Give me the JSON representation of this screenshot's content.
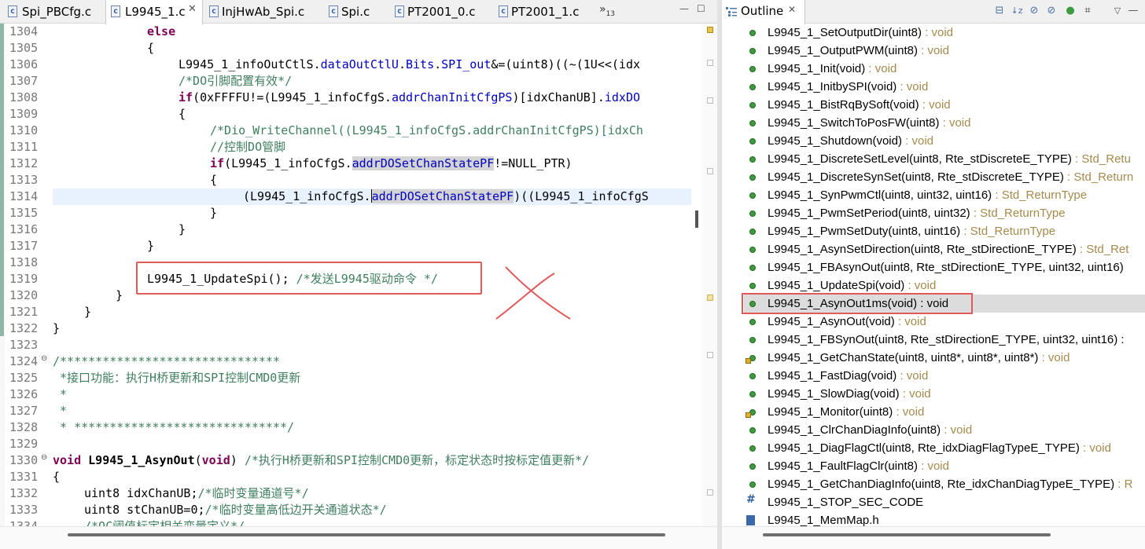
{
  "editor": {
    "tabs": [
      {
        "label": "Spi_PBCfg.c",
        "active": false
      },
      {
        "label": "L9945_1.c",
        "active": true
      },
      {
        "label": "InjHwAb_Spi.c",
        "active": false
      },
      {
        "label": "Spi.c",
        "active": false
      },
      {
        "label": "PT2001_0.c",
        "active": false
      },
      {
        "label": "PT2001_1.c",
        "active": false
      }
    ],
    "overflow_label": "»",
    "overflow_count": "13",
    "line_numbers": [
      "1304",
      "1305",
      "1306",
      "1307",
      "1308",
      "1309",
      "1310",
      "1311",
      "1312",
      "1313",
      "1314",
      "1315",
      "1316",
      "1317",
      "1318",
      "1319",
      "1320",
      "1321",
      "1322",
      "1323",
      "1324",
      "1325",
      "1326",
      "1327",
      "1328",
      "1329",
      "1330",
      "1331",
      "1332",
      "1333",
      "1334"
    ],
    "code": {
      "l1304_kw": "else",
      "l1305": "{",
      "l1306_a": "L9945_1_infoOutCtlS.",
      "l1306_f1": "dataOutCtlU",
      "l1306_b": ".",
      "l1306_f2": "Bits",
      "l1306_c": ".",
      "l1306_f3": "SPI_out",
      "l1306_d": "&=(uint8)((~(1U<<(idx",
      "l1307_cm": "/*DO引脚配置有效*/",
      "l1308_kw": "if",
      "l1308_a": "(0xFFFFU!=(L9945_1_infoCfgS.",
      "l1308_f1": "addrChanInitCfgPS",
      "l1308_b": ")[idxChanUB].",
      "l1308_f2": "idxDO",
      "l1309": "{",
      "l1310_cm": "/*Dio_WriteChannel((L9945_1_infoCfgS.addrChanInitCfgPS)[idxCh",
      "l1311_cm": "//控制DO管脚",
      "l1312_kw": "if",
      "l1312_a": "(L9945_1_infoCfgS.",
      "l1312_f1": "addrDOSetChanStatePF",
      "l1312_b": "!=NULL_PTR)",
      "l1313": "{",
      "l1314_a": "(L9945_1_infoCfgS.",
      "l1314_f1a": "a",
      "l1314_f1b": "ddrDOSetChanStatePF",
      "l1314_b": ")((L9945_1_infoCfgS",
      "l1315": "}",
      "l1316": "}",
      "l1317": "}",
      "l1319_a": "L9945_1_UpdateSpi(); ",
      "l1319_cm": "/*发送L9945驱动命令 */",
      "l1320": "}",
      "l1321": "}",
      "l1322": "}",
      "l1324_cm": "/*******************************",
      "l1325_cm": " *接口功能：执行H桥更新和SPI控制CMD0更新",
      "l1326_cm": " *",
      "l1327_cm": " *",
      "l1328_cm": " * ******************************/",
      "l1330_kw": "void",
      "l1330_fn": " L9945_1_AsynOut",
      "l1330_p1": "(",
      "l1330_kw2": "void",
      "l1330_p2": ") ",
      "l1330_cm": "/*执行H桥更新和SPI控制CMD0更新，标定状态时按标定值更新*/",
      "l1331": "{",
      "l1332_a": "uint8 idxChanUB;",
      "l1332_cm": "/*临时变量通道号*/",
      "l1333_a": "uint8 stChanUB=0;",
      "l1333_cm": "/*临时变量高低边开关通道状态*/",
      "l1334_cm": "/*OC阈值标定相关变量定义*/"
    }
  },
  "outline": {
    "title": "Outline",
    "items": [
      {
        "name": "L9945_1_SetOutputDir(uint8)",
        "ret": " : void",
        "icon": "dot"
      },
      {
        "name": "L9945_1_OutputPWM(uint8)",
        "ret": " : void",
        "icon": "dot"
      },
      {
        "name": "L9945_1_Init(void)",
        "ret": " : void",
        "icon": "dot"
      },
      {
        "name": "L9945_1_InitbySPI(void)",
        "ret": " : void",
        "icon": "dot"
      },
      {
        "name": "L9945_1_BistRqBySoft(void)",
        "ret": " : void",
        "icon": "dot"
      },
      {
        "name": "L9945_1_SwitchToPosFW(uint8)",
        "ret": " : void",
        "icon": "dot"
      },
      {
        "name": "L9945_1_Shutdown(void)",
        "ret": " : void",
        "icon": "dot"
      },
      {
        "name": "L9945_1_DiscreteSetLevel(uint8, Rte_stDiscreteE_TYPE)",
        "ret": " : Std_Retu",
        "icon": "dot"
      },
      {
        "name": "L9945_1_DiscreteSynSet(uint8, Rte_stDiscreteE_TYPE)",
        "ret": " : Std_Return",
        "icon": "dot"
      },
      {
        "name": "L9945_1_SynPwmCtl(uint8, uint32, uint16)",
        "ret": " : Std_ReturnType",
        "icon": "dot"
      },
      {
        "name": "L9945_1_PwmSetPeriod(uint8, uint32)",
        "ret": " : Std_ReturnType",
        "icon": "dot"
      },
      {
        "name": "L9945_1_PwmSetDuty(uint8, uint16)",
        "ret": " : Std_ReturnType",
        "icon": "dot"
      },
      {
        "name": "L9945_1_AsynSetDirection(uint8, Rte_stDirectionE_TYPE)",
        "ret": " : Std_Ret",
        "icon": "dot"
      },
      {
        "name": "L9945_1_FBAsynOut(uint8, Rte_stDirectionE_TYPE, uint32, uint16)",
        "ret": "",
        "icon": "dot"
      },
      {
        "name": "L9945_1_UpdateSpi(void)",
        "ret": " : void",
        "icon": "dot"
      },
      {
        "name": "L9945_1_AsynOut1ms(void) : void",
        "ret": "",
        "icon": "dot",
        "selected": true
      },
      {
        "name": "L9945_1_AsynOut(void)",
        "ret": " : void",
        "icon": "dot"
      },
      {
        "name": "L9945_1_FBSynOut(uint8, Rte_stDirectionE_TYPE, uint32, uint16) :",
        "ret": "",
        "icon": "dot"
      },
      {
        "name": "L9945_1_GetChanState(uint8, uint8*, uint8*, uint8*)",
        "ret": " : void",
        "icon": "dot-lock"
      },
      {
        "name": "L9945_1_FastDiag(void)",
        "ret": " : void",
        "icon": "dot"
      },
      {
        "name": "L9945_1_SlowDiag(void)",
        "ret": " : void",
        "icon": "dot"
      },
      {
        "name": "L9945_1_Monitor(uint8)",
        "ret": " : void",
        "icon": "dot-lock"
      },
      {
        "name": "L9945_1_ClrChanDiagInfo(uint8)",
        "ret": " : void",
        "icon": "dot"
      },
      {
        "name": "L9945_1_DiagFlagCtl(uint8, Rte_idxDiagFlagTypeE_TYPE)",
        "ret": " : void",
        "icon": "dot"
      },
      {
        "name": "L9945_1_FaultFlagClr(uint8)",
        "ret": " : void",
        "icon": "dot"
      },
      {
        "name": "L9945_1_GetChanDiagInfo(uint8, Rte_idxChanDiagTypeE_TYPE)",
        "ret": " : R",
        "icon": "dot"
      },
      {
        "name": "L9945_1_STOP_SEC_CODE",
        "ret": "",
        "icon": "hash"
      },
      {
        "name": "L9945_1_MemMap.h",
        "ret": "",
        "icon": "include"
      }
    ]
  }
}
